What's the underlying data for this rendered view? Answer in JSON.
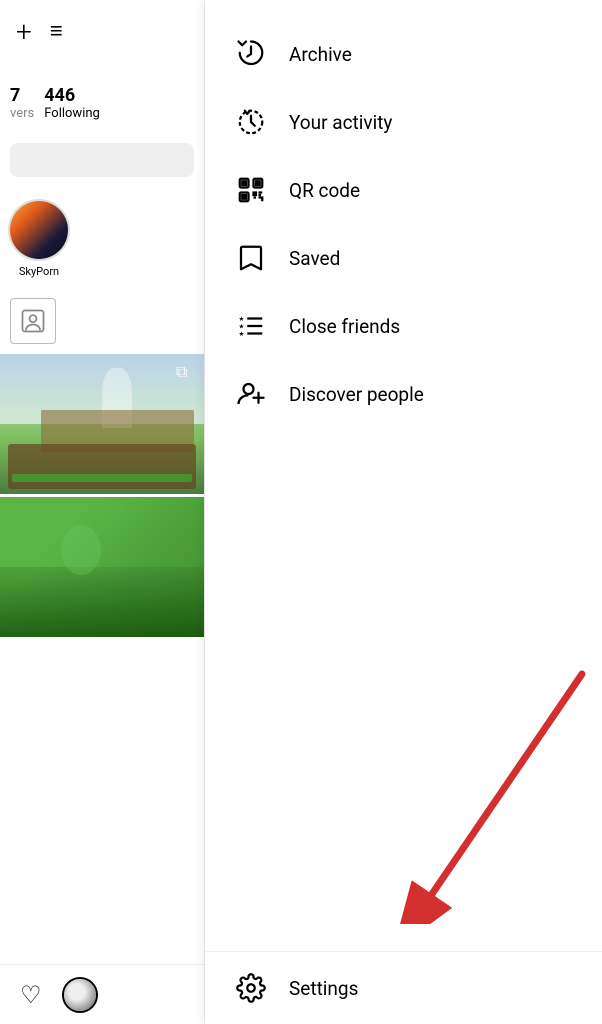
{
  "left_panel": {
    "top_icons": {
      "plus_label": "+",
      "menu_label": "≡"
    },
    "stats": {
      "followers_partial": "7",
      "followers_label": "vers",
      "following_number": "446",
      "following_label": "Following"
    },
    "stories": [
      {
        "label": "SkyPorn",
        "type": "sunset"
      }
    ],
    "bottom_bar": {
      "heart": "♡"
    }
  },
  "menu": {
    "items": [
      {
        "id": "archive",
        "label": "Archive",
        "icon": "archive"
      },
      {
        "id": "activity",
        "label": "Your activity",
        "icon": "activity"
      },
      {
        "id": "qr",
        "label": "QR code",
        "icon": "qr"
      },
      {
        "id": "saved",
        "label": "Saved",
        "icon": "saved"
      },
      {
        "id": "close-friends",
        "label": "Close friends",
        "icon": "close-friends"
      },
      {
        "id": "discover",
        "label": "Discover people",
        "icon": "discover"
      }
    ],
    "settings": {
      "label": "Settings",
      "icon": "settings"
    }
  }
}
